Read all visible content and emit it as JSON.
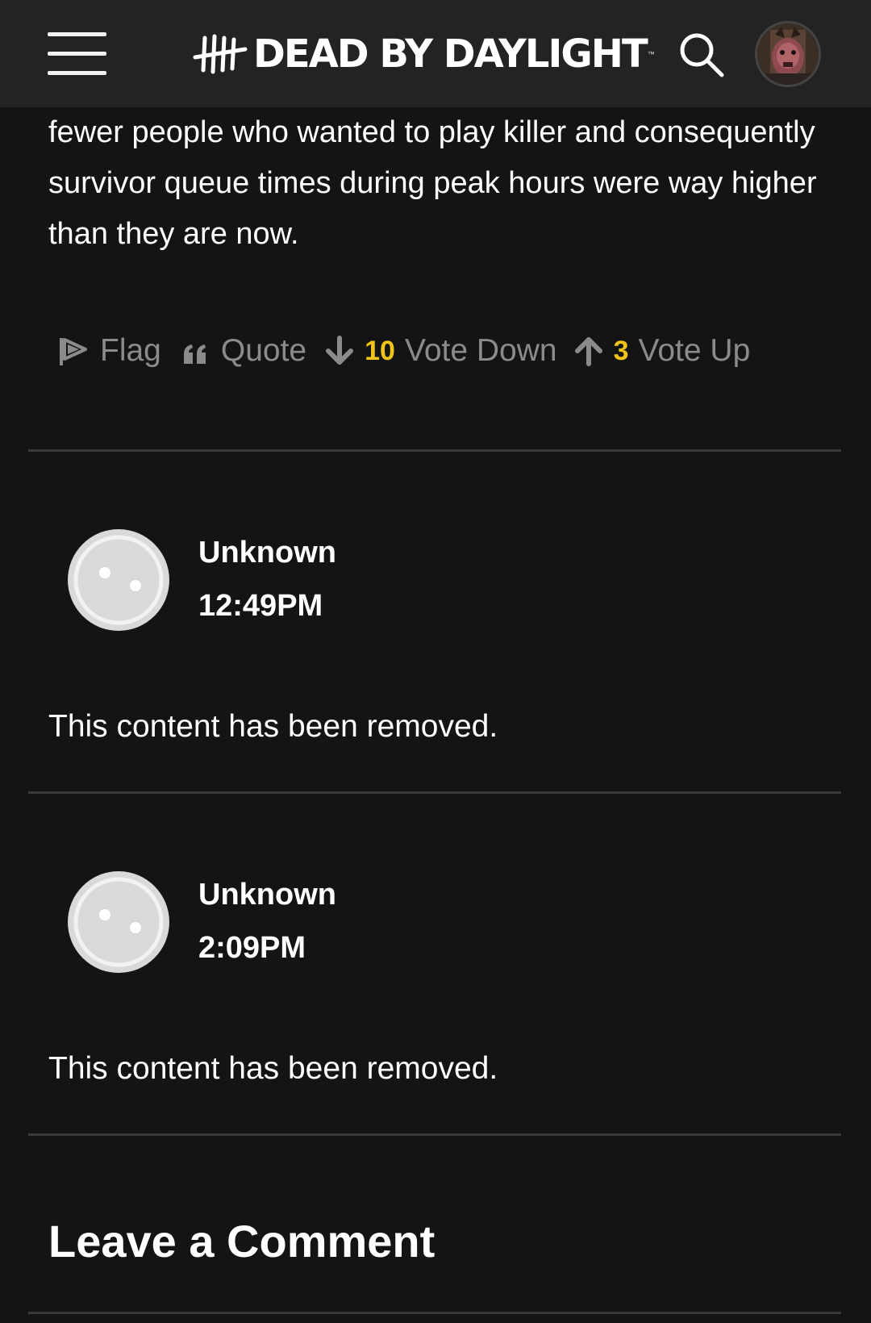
{
  "header": {
    "logo_text": "DEAD BY DAYLIGHT",
    "logo_tm": "™",
    "menu_icon": "hamburger-menu-icon",
    "search_icon": "search-icon",
    "avatar_icon": "user-avatar-icon"
  },
  "post": {
    "text": "fewer people who wanted to play killer and consequently survivor queue times during peak hours were way higher than they are now.",
    "actions": {
      "flag_label": "Flag",
      "quote_label": "Quote",
      "vote_down_count": "10",
      "vote_down_label": "Vote Down",
      "vote_up_count": "3",
      "vote_up_label": "Vote Up"
    }
  },
  "comments": [
    {
      "author": "Unknown",
      "time": "12:49PM",
      "body": "This content has been removed."
    },
    {
      "author": "Unknown",
      "time": "2:09PM",
      "body": "This content has been removed."
    }
  ],
  "leave_comment": {
    "heading": "Leave a Comment"
  },
  "colors": {
    "background": "#141414",
    "header": "#232323",
    "vote_count": "#f0c419",
    "action_text": "#8b8b8b",
    "divider": "#3a3a3a"
  }
}
